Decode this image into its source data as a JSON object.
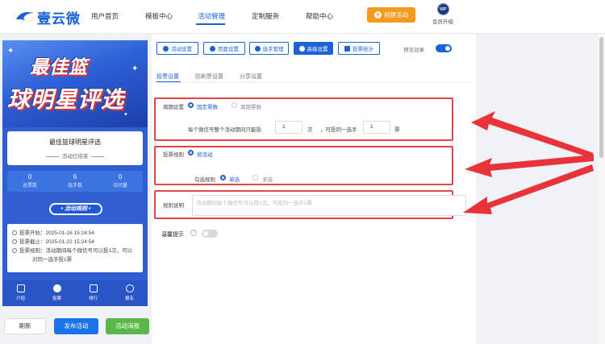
{
  "logo": {
    "text": "壹云微"
  },
  "nav": [
    {
      "label": "用户首页"
    },
    {
      "label": "模板中心"
    },
    {
      "label": "活动管理",
      "active": true
    },
    {
      "label": "定制服务"
    },
    {
      "label": "帮助中心"
    }
  ],
  "header": {
    "create_btn": "创建活动",
    "vip_badge": "VIP",
    "vip_label": "会员升级"
  },
  "preview": {
    "banner_line1": "最佳篮",
    "banner_line2": "球明星评选",
    "title": "最佳篮球明星评选",
    "status": "活动已结束",
    "stats": [
      {
        "value": "0",
        "label": "总票数"
      },
      {
        "value": "6",
        "label": "选手数"
      },
      {
        "value": "0",
        "label": "访问量"
      }
    ],
    "rule_button": "• 活动规则 •",
    "info": [
      "投票开始：2025-01-16 15:24:54",
      "投票截止：2025-01-22 15:24:54",
      "投票规则：活动期间每个微信号可以投1次，可以",
      "对同一选手投1票"
    ],
    "tabs": [
      {
        "label": "介绍"
      },
      {
        "label": "投票"
      },
      {
        "label": "排行"
      },
      {
        "label": "报名"
      }
    ]
  },
  "bottom_buttons": {
    "refresh": "刷新",
    "publish": "发布活动",
    "poster": "活动海报"
  },
  "toolbar": [
    {
      "label": "活动设置"
    },
    {
      "label": "页面设置"
    },
    {
      "label": "选手管理"
    },
    {
      "label": "高级设置",
      "active": true
    },
    {
      "label": "投票统计"
    }
  ],
  "preview_effect": {
    "label": "预览效果",
    "enabled": true
  },
  "subtabs": [
    {
      "label": "投票设置",
      "active": true
    },
    {
      "label": "防刷票设置"
    },
    {
      "label": "分享设置"
    }
  ],
  "cycle": {
    "label": "周期设置",
    "options": [
      {
        "label": "固定票数",
        "selected": true
      },
      {
        "label": "周期票数",
        "selected": false
      }
    ],
    "line_prefix": "每个微信号整个活动期间只能投",
    "votes": "1",
    "unit1": "次",
    "line_mid": "，可投同一选手",
    "per_player": "1",
    "unit2": "票"
  },
  "rule": {
    "label": "投票规则",
    "option": "按活动",
    "check_label": "勾选规则",
    "check_options": [
      {
        "label": "单选",
        "selected": true
      },
      {
        "label": "多选",
        "selected": false
      }
    ]
  },
  "desc": {
    "label": "规则说明",
    "placeholder": "活动期间每个微信号可以投1次，可投同一选手1票"
  },
  "warm_tip": {
    "label": "温馨提示",
    "help": "?",
    "enabled": false
  },
  "colors": {
    "primary": "#1a62d6",
    "accent": "#f39a1f",
    "highlight": "#e54545",
    "success": "#5ab74a"
  }
}
